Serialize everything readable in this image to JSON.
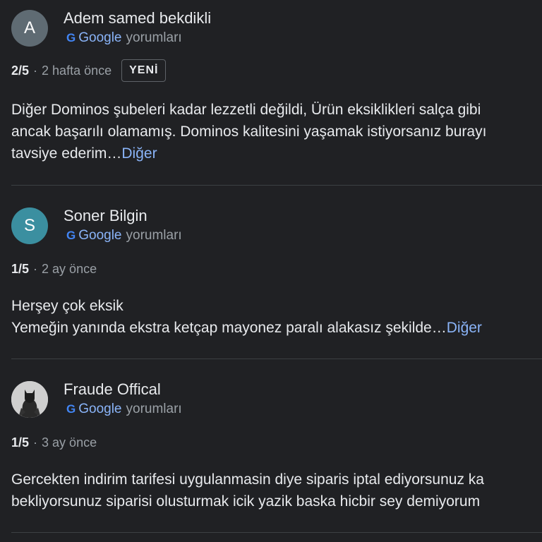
{
  "reviews": [
    {
      "avatar_letter": "A",
      "avatar_color": "#5f6b73",
      "name": "Adem samed bekdikli",
      "source": {
        "g": "G",
        "brand": "Google",
        "suffix": "yorumları"
      },
      "rating": "2/5",
      "time": "2 hafta önce",
      "badge": "YENİ",
      "lines": [
        "Diğer Dominos şubeleri kadar lezzetli değildi, Ürün eksiklikleri salça gibi",
        "ancak başarılı olamamış. Dominos kalitesini yaşamak istiyorsanız burayı",
        "tavsiye ederim…"
      ],
      "more": "Diğer"
    },
    {
      "avatar_letter": "S",
      "avatar_color": "#3b8fa0",
      "name": "Soner Bilgin",
      "source": {
        "g": "G",
        "brand": "Google",
        "suffix": "yorumları"
      },
      "rating": "1/5",
      "time": "2 ay önce",
      "lines": [
        "Herşey çok eksik",
        "Yemeğin yanında ekstra ketçap mayonez paralı alakasız şekilde…"
      ],
      "more": "Diğer"
    },
    {
      "avatar_icon": "batman-avatar-icon",
      "name": "Fraude Offical",
      "source": {
        "g": "G",
        "brand": "Google",
        "suffix": "yorumları"
      },
      "rating": "1/5",
      "time": "3 ay önce",
      "lines": [
        "Gercekten indirim tarifesi uygulanmasin diye siparis iptal ediyorsunuz ka",
        "bekliyorsunuz siparisi olusturmak icik yazik baska hicbir sey demiyorum"
      ]
    }
  ],
  "separator": "·",
  "colors": {
    "background": "#202124",
    "text": "#e8eaed",
    "secondary": "#9aa0a6",
    "link": "#8ab4f8",
    "divider": "#3c4043",
    "google_blue": "#4285f4"
  }
}
